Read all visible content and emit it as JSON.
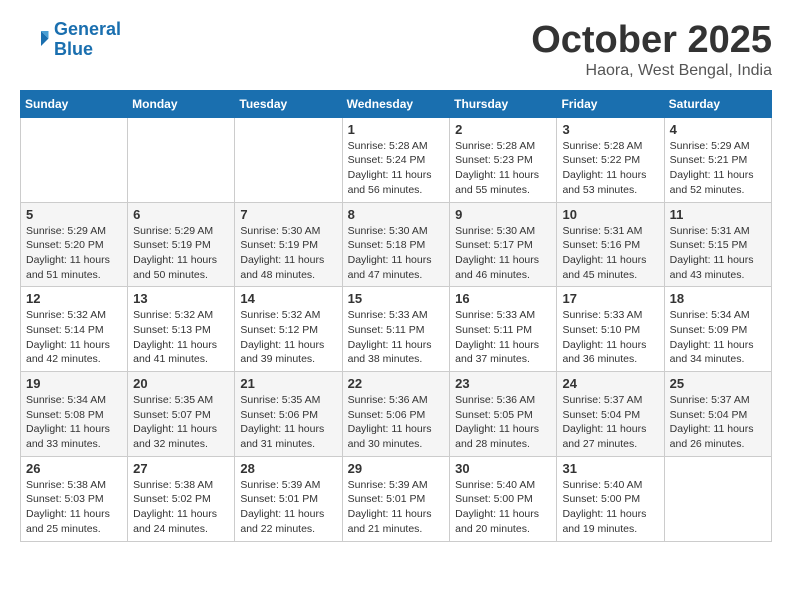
{
  "logo": {
    "line1": "General",
    "line2": "Blue"
  },
  "title": "October 2025",
  "subtitle": "Haora, West Bengal, India",
  "weekdays": [
    "Sunday",
    "Monday",
    "Tuesday",
    "Wednesday",
    "Thursday",
    "Friday",
    "Saturday"
  ],
  "rows": [
    [
      {
        "day": "",
        "info": ""
      },
      {
        "day": "",
        "info": ""
      },
      {
        "day": "",
        "info": ""
      },
      {
        "day": "1",
        "info": "Sunrise: 5:28 AM\nSunset: 5:24 PM\nDaylight: 11 hours\nand 56 minutes."
      },
      {
        "day": "2",
        "info": "Sunrise: 5:28 AM\nSunset: 5:23 PM\nDaylight: 11 hours\nand 55 minutes."
      },
      {
        "day": "3",
        "info": "Sunrise: 5:28 AM\nSunset: 5:22 PM\nDaylight: 11 hours\nand 53 minutes."
      },
      {
        "day": "4",
        "info": "Sunrise: 5:29 AM\nSunset: 5:21 PM\nDaylight: 11 hours\nand 52 minutes."
      }
    ],
    [
      {
        "day": "5",
        "info": "Sunrise: 5:29 AM\nSunset: 5:20 PM\nDaylight: 11 hours\nand 51 minutes."
      },
      {
        "day": "6",
        "info": "Sunrise: 5:29 AM\nSunset: 5:19 PM\nDaylight: 11 hours\nand 50 minutes."
      },
      {
        "day": "7",
        "info": "Sunrise: 5:30 AM\nSunset: 5:19 PM\nDaylight: 11 hours\nand 48 minutes."
      },
      {
        "day": "8",
        "info": "Sunrise: 5:30 AM\nSunset: 5:18 PM\nDaylight: 11 hours\nand 47 minutes."
      },
      {
        "day": "9",
        "info": "Sunrise: 5:30 AM\nSunset: 5:17 PM\nDaylight: 11 hours\nand 46 minutes."
      },
      {
        "day": "10",
        "info": "Sunrise: 5:31 AM\nSunset: 5:16 PM\nDaylight: 11 hours\nand 45 minutes."
      },
      {
        "day": "11",
        "info": "Sunrise: 5:31 AM\nSunset: 5:15 PM\nDaylight: 11 hours\nand 43 minutes."
      }
    ],
    [
      {
        "day": "12",
        "info": "Sunrise: 5:32 AM\nSunset: 5:14 PM\nDaylight: 11 hours\nand 42 minutes."
      },
      {
        "day": "13",
        "info": "Sunrise: 5:32 AM\nSunset: 5:13 PM\nDaylight: 11 hours\nand 41 minutes."
      },
      {
        "day": "14",
        "info": "Sunrise: 5:32 AM\nSunset: 5:12 PM\nDaylight: 11 hours\nand 39 minutes."
      },
      {
        "day": "15",
        "info": "Sunrise: 5:33 AM\nSunset: 5:11 PM\nDaylight: 11 hours\nand 38 minutes."
      },
      {
        "day": "16",
        "info": "Sunrise: 5:33 AM\nSunset: 5:11 PM\nDaylight: 11 hours\nand 37 minutes."
      },
      {
        "day": "17",
        "info": "Sunrise: 5:33 AM\nSunset: 5:10 PM\nDaylight: 11 hours\nand 36 minutes."
      },
      {
        "day": "18",
        "info": "Sunrise: 5:34 AM\nSunset: 5:09 PM\nDaylight: 11 hours\nand 34 minutes."
      }
    ],
    [
      {
        "day": "19",
        "info": "Sunrise: 5:34 AM\nSunset: 5:08 PM\nDaylight: 11 hours\nand 33 minutes."
      },
      {
        "day": "20",
        "info": "Sunrise: 5:35 AM\nSunset: 5:07 PM\nDaylight: 11 hours\nand 32 minutes."
      },
      {
        "day": "21",
        "info": "Sunrise: 5:35 AM\nSunset: 5:06 PM\nDaylight: 11 hours\nand 31 minutes."
      },
      {
        "day": "22",
        "info": "Sunrise: 5:36 AM\nSunset: 5:06 PM\nDaylight: 11 hours\nand 30 minutes."
      },
      {
        "day": "23",
        "info": "Sunrise: 5:36 AM\nSunset: 5:05 PM\nDaylight: 11 hours\nand 28 minutes."
      },
      {
        "day": "24",
        "info": "Sunrise: 5:37 AM\nSunset: 5:04 PM\nDaylight: 11 hours\nand 27 minutes."
      },
      {
        "day": "25",
        "info": "Sunrise: 5:37 AM\nSunset: 5:04 PM\nDaylight: 11 hours\nand 26 minutes."
      }
    ],
    [
      {
        "day": "26",
        "info": "Sunrise: 5:38 AM\nSunset: 5:03 PM\nDaylight: 11 hours\nand 25 minutes."
      },
      {
        "day": "27",
        "info": "Sunrise: 5:38 AM\nSunset: 5:02 PM\nDaylight: 11 hours\nand 24 minutes."
      },
      {
        "day": "28",
        "info": "Sunrise: 5:39 AM\nSunset: 5:01 PM\nDaylight: 11 hours\nand 22 minutes."
      },
      {
        "day": "29",
        "info": "Sunrise: 5:39 AM\nSunset: 5:01 PM\nDaylight: 11 hours\nand 21 minutes."
      },
      {
        "day": "30",
        "info": "Sunrise: 5:40 AM\nSunset: 5:00 PM\nDaylight: 11 hours\nand 20 minutes."
      },
      {
        "day": "31",
        "info": "Sunrise: 5:40 AM\nSunset: 5:00 PM\nDaylight: 11 hours\nand 19 minutes."
      },
      {
        "day": "",
        "info": ""
      }
    ]
  ]
}
